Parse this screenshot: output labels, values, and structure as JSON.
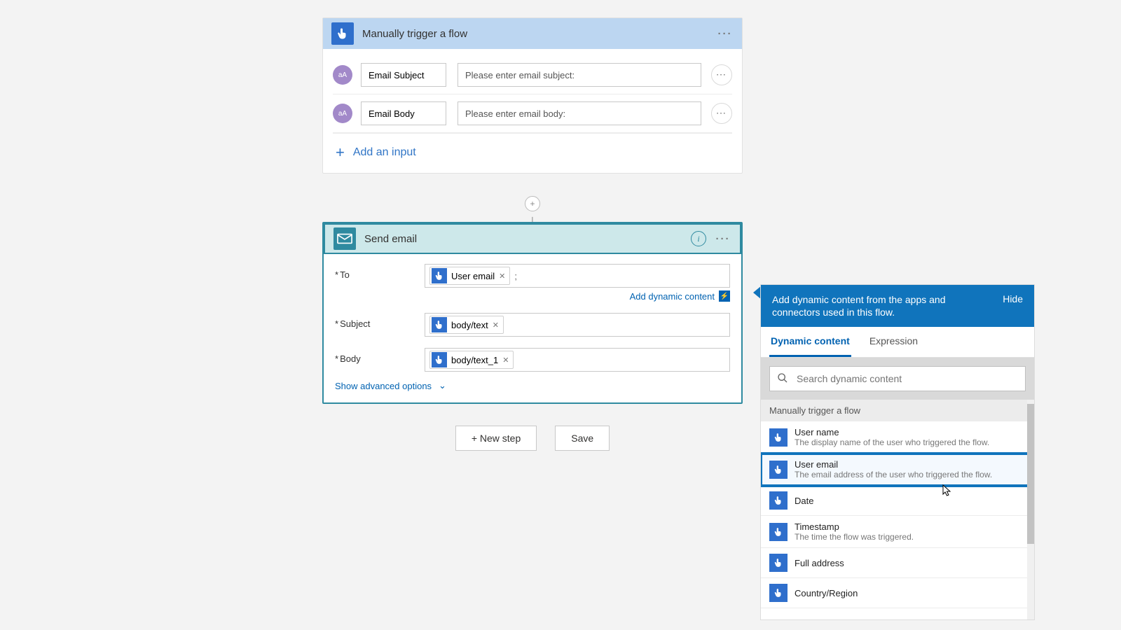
{
  "trigger": {
    "title": "Manually trigger a flow",
    "inputs": [
      {
        "badge": "aA",
        "name": "Email Subject",
        "placeholder": "Please enter email subject:"
      },
      {
        "badge": "aA",
        "name": "Email Body",
        "placeholder": "Please enter email body:"
      }
    ],
    "add_input": "Add an input"
  },
  "action": {
    "title": "Send email",
    "fields": {
      "to_label": "To",
      "subject_label": "Subject",
      "body_label": "Body",
      "to_token": "User email",
      "to_after": ";",
      "subject_token": "body/text",
      "body_token": "body/text_1"
    },
    "add_dynamic": "Add dynamic content",
    "show_advanced": "Show advanced options"
  },
  "buttons": {
    "new_step": "+ New step",
    "save": "Save"
  },
  "flyout": {
    "header_msg": "Add dynamic content from the apps and connectors used in this flow.",
    "hide": "Hide",
    "tab_dynamic": "Dynamic content",
    "tab_expression": "Expression",
    "search_placeholder": "Search dynamic content",
    "group_header": "Manually trigger a flow",
    "items": [
      {
        "title": "User name",
        "desc": "The display name of the user who triggered the flow."
      },
      {
        "title": "User email",
        "desc": "The email address of the user who triggered the flow."
      },
      {
        "title": "Date",
        "desc": ""
      },
      {
        "title": "Timestamp",
        "desc": "The time the flow was triggered."
      },
      {
        "title": "Full address",
        "desc": ""
      },
      {
        "title": "Country/Region",
        "desc": ""
      }
    ]
  }
}
